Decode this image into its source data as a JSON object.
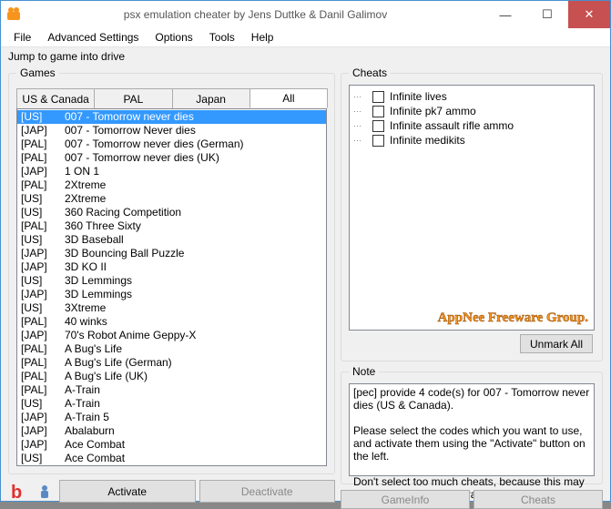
{
  "window": {
    "title": "psx emulation cheater by Jens Duttke & Danil Galimov"
  },
  "menu": {
    "items": [
      "File",
      "Advanced Settings",
      "Options",
      "Tools",
      "Help"
    ]
  },
  "jump_label": "Jump to game into drive",
  "games": {
    "legend": "Games",
    "tabs": [
      "US & Canada",
      "PAL",
      "Japan",
      "All"
    ],
    "active_tab": 3,
    "selected_index": 0,
    "list": [
      {
        "region": "[US]",
        "title": "007 - Tomorrow never dies"
      },
      {
        "region": "[JAP]",
        "title": "007 - Tomorrow Never dies"
      },
      {
        "region": "[PAL]",
        "title": "007 - Tomorrow never dies (German)"
      },
      {
        "region": "[PAL]",
        "title": "007 - Tomorrow never dies (UK)"
      },
      {
        "region": "[JAP]",
        "title": "1 ON 1"
      },
      {
        "region": "[PAL]",
        "title": "2Xtreme"
      },
      {
        "region": "[US]",
        "title": "2Xtreme"
      },
      {
        "region": "[US]",
        "title": "360 Racing Competition"
      },
      {
        "region": "[PAL]",
        "title": "360 Three Sixty"
      },
      {
        "region": "[US]",
        "title": "3D Baseball"
      },
      {
        "region": "[JAP]",
        "title": "3D Bouncing Ball Puzzle"
      },
      {
        "region": "[JAP]",
        "title": "3D KO II"
      },
      {
        "region": "[US]",
        "title": "3D Lemmings"
      },
      {
        "region": "[JAP]",
        "title": "3D Lemmings"
      },
      {
        "region": "[US]",
        "title": "3Xtreme"
      },
      {
        "region": "[PAL]",
        "title": "40 winks"
      },
      {
        "region": "[JAP]",
        "title": "70's Robot Anime Geppy-X"
      },
      {
        "region": "[PAL]",
        "title": "A Bug's Life"
      },
      {
        "region": "[PAL]",
        "title": "A Bug's Life (German)"
      },
      {
        "region": "[PAL]",
        "title": "A Bug's Life (UK)"
      },
      {
        "region": "[PAL]",
        "title": "A-Train"
      },
      {
        "region": "[US]",
        "title": "A-Train"
      },
      {
        "region": "[JAP]",
        "title": "A-Train 5"
      },
      {
        "region": "[JAP]",
        "title": "Abalaburn"
      },
      {
        "region": "[JAP]",
        "title": "Ace Combat"
      },
      {
        "region": "[US]",
        "title": "Ace Combat"
      }
    ]
  },
  "cheats": {
    "legend": "Cheats",
    "list": [
      "Infinite lives",
      "Infinite pk7 ammo",
      "Infinite assault rifle ammo",
      "Infinite medikits"
    ],
    "watermark": "AppNee Freeware Group.",
    "unmark_button": "Unmark All"
  },
  "note": {
    "legend": "Note",
    "text": "[pec] provide 4 code(s) for 007 - Tomorrow never dies (US & Canada).\n\nPlease select the codes which you want to use, and activate them using the \"Activate\" button on the left.\n\nDon't select too much cheats, because this may cause the emulator to crash."
  },
  "bottom": {
    "activate": "Activate",
    "deactivate": "Deactivate",
    "gameinfo": "GameInfo",
    "cheats": "Cheats"
  }
}
